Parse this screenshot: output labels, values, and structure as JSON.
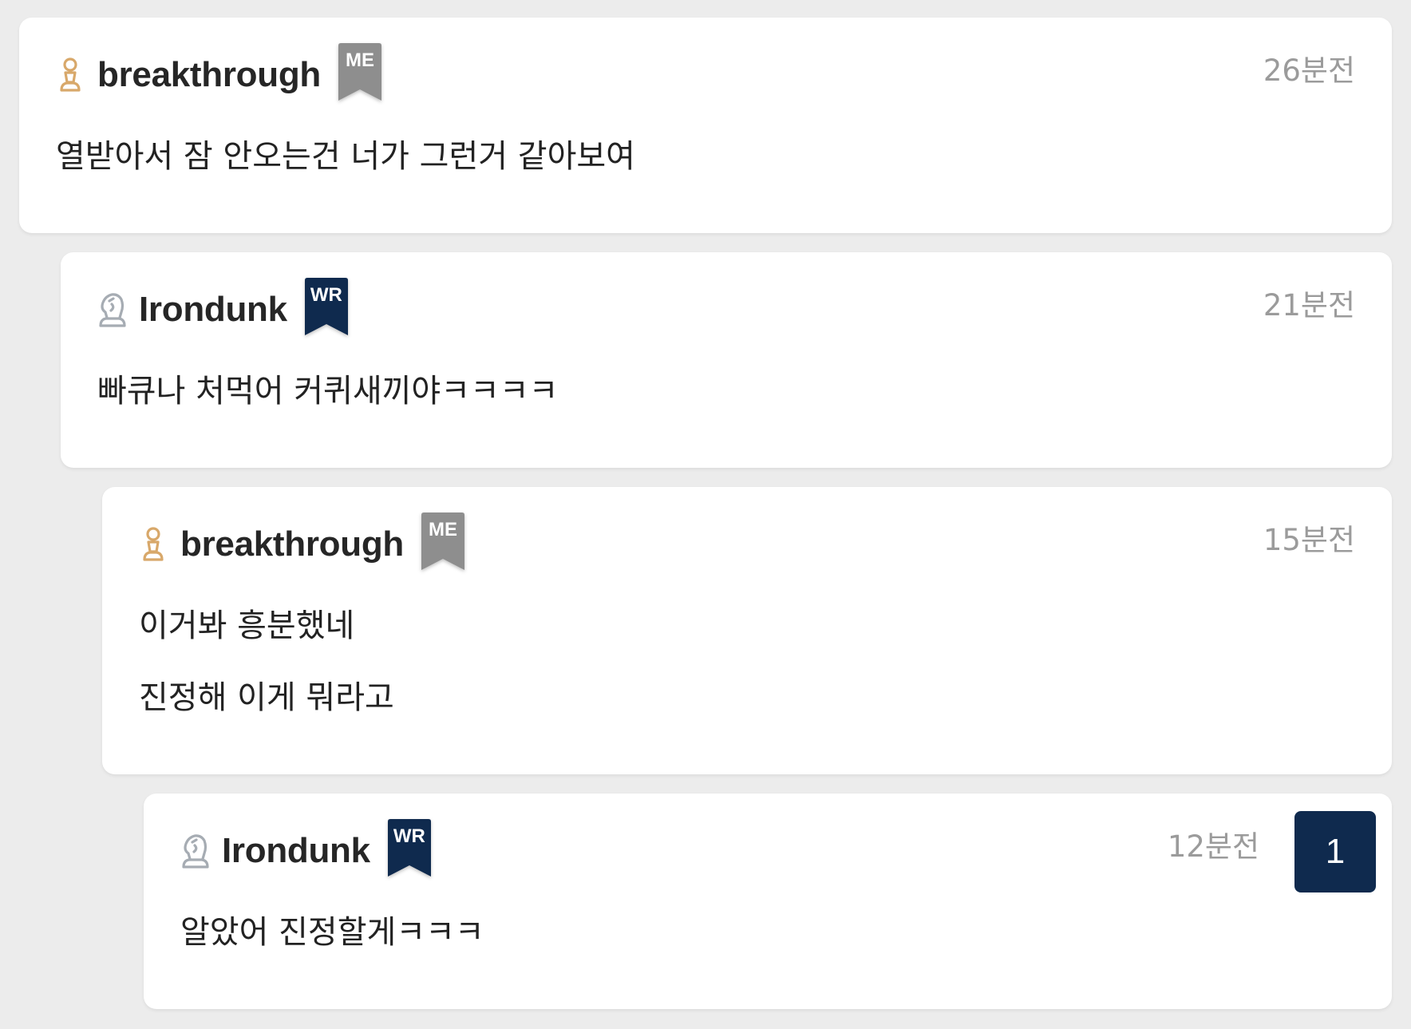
{
  "colors": {
    "background": "#ececec",
    "card": "#ffffff",
    "me_badge": "#8e8e8e",
    "wr_badge": "#0f2a4e",
    "rank_gold": "#d8a86a",
    "rank_silver": "#a6acb3",
    "timestamp": "#9b9b9b",
    "counter_bg": "#0f2a4e"
  },
  "comments": [
    {
      "username": "breakthrough",
      "rank_icon": "pawn-gold-icon",
      "badge": "ME",
      "timestamp": "26분전",
      "lines": [
        "열받아서 잠 안오는건 너가 그런거 같아보여"
      ]
    },
    {
      "username": "Irondunk",
      "rank_icon": "knight-silver-icon",
      "badge": "WR",
      "timestamp": "21분전",
      "lines": [
        "빠큐나 처먹어 커퀴새끼야ㅋㅋㅋㅋ"
      ]
    },
    {
      "username": "breakthrough",
      "rank_icon": "pawn-gold-icon",
      "badge": "ME",
      "timestamp": "15분전",
      "lines": [
        "이거봐 흥분했네",
        "진정해 이게 뭐라고"
      ]
    },
    {
      "username": "Irondunk",
      "rank_icon": "knight-silver-icon",
      "badge": "WR",
      "timestamp": "12분전",
      "counter": "1",
      "lines": [
        "알았어 진정할게ㅋㅋㅋ"
      ]
    }
  ]
}
